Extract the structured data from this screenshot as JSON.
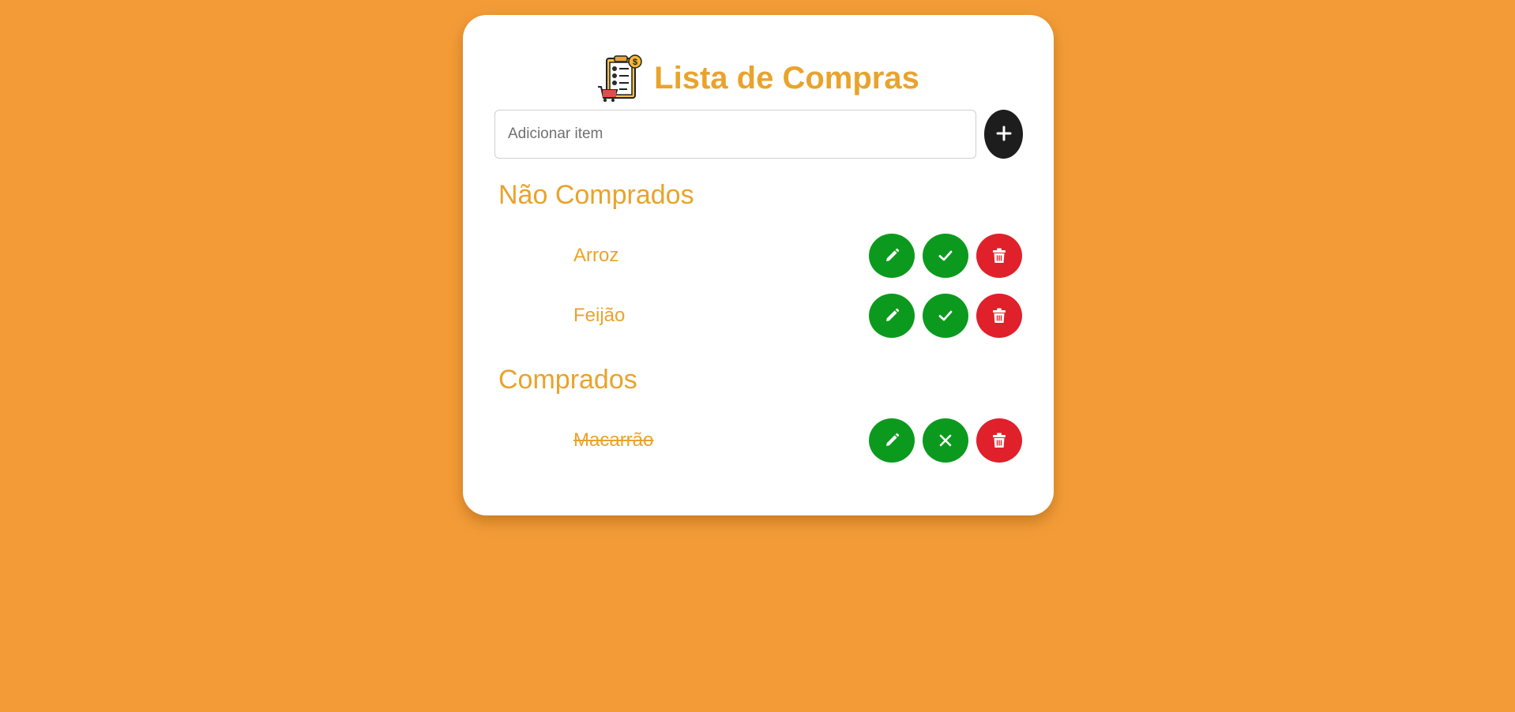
{
  "app": {
    "title": "Lista de Compras",
    "logo_icon": "shopping-checklist-icon"
  },
  "add_item": {
    "placeholder": "Adicionar item",
    "value": "",
    "button_icon": "plus-icon"
  },
  "sections": {
    "pending": {
      "title": "Não Comprados",
      "items": [
        {
          "name": "Arroz",
          "actions": [
            "edit",
            "mark-bought",
            "delete"
          ]
        },
        {
          "name": "Feijão",
          "actions": [
            "edit",
            "mark-bought",
            "delete"
          ]
        }
      ]
    },
    "bought": {
      "title": "Comprados",
      "items": [
        {
          "name": "Macarrão",
          "actions": [
            "edit",
            "unmark-bought",
            "delete"
          ]
        }
      ]
    }
  },
  "colors": {
    "background": "#f39c37",
    "accent_text": "#e9a32c",
    "action_green": "#0b9a1d",
    "action_red": "#e0202a",
    "add_button": "#1d1d1d"
  }
}
